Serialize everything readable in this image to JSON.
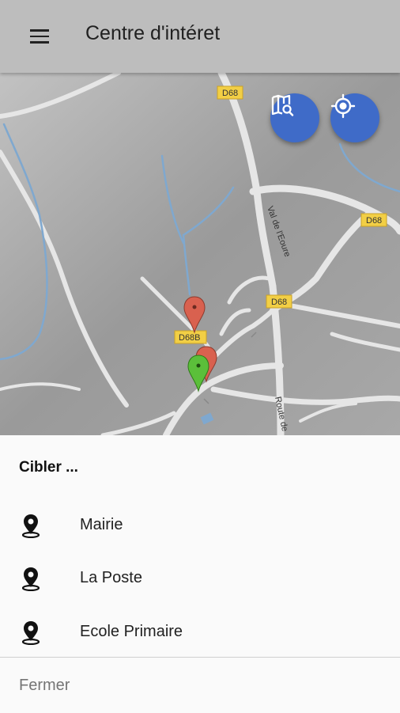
{
  "appbar": {
    "title": "Centre d'intéret",
    "menu_icon": "hamburger-menu-icon"
  },
  "map": {
    "road_labels": [
      "D68",
      "D68",
      "D68",
      "D68B",
      "Val de l'Eoure",
      "Route de"
    ],
    "buttons": {
      "map_search_icon": "map-search-icon",
      "locate_icon": "gps-target-icon"
    },
    "colors": {
      "fab": "#3f6bc8",
      "marker_red": "#d9614f",
      "marker_green": "#5bbf3a",
      "road_badge": "#f2cf45"
    }
  },
  "sheet": {
    "title": "Cibler ...",
    "items": [
      {
        "label": "Mairie",
        "icon": "map-pin-icon"
      },
      {
        "label": "La Poste",
        "icon": "map-pin-icon"
      },
      {
        "label": "Ecole Primaire",
        "icon": "map-pin-icon"
      }
    ],
    "close_label": "Fermer"
  }
}
